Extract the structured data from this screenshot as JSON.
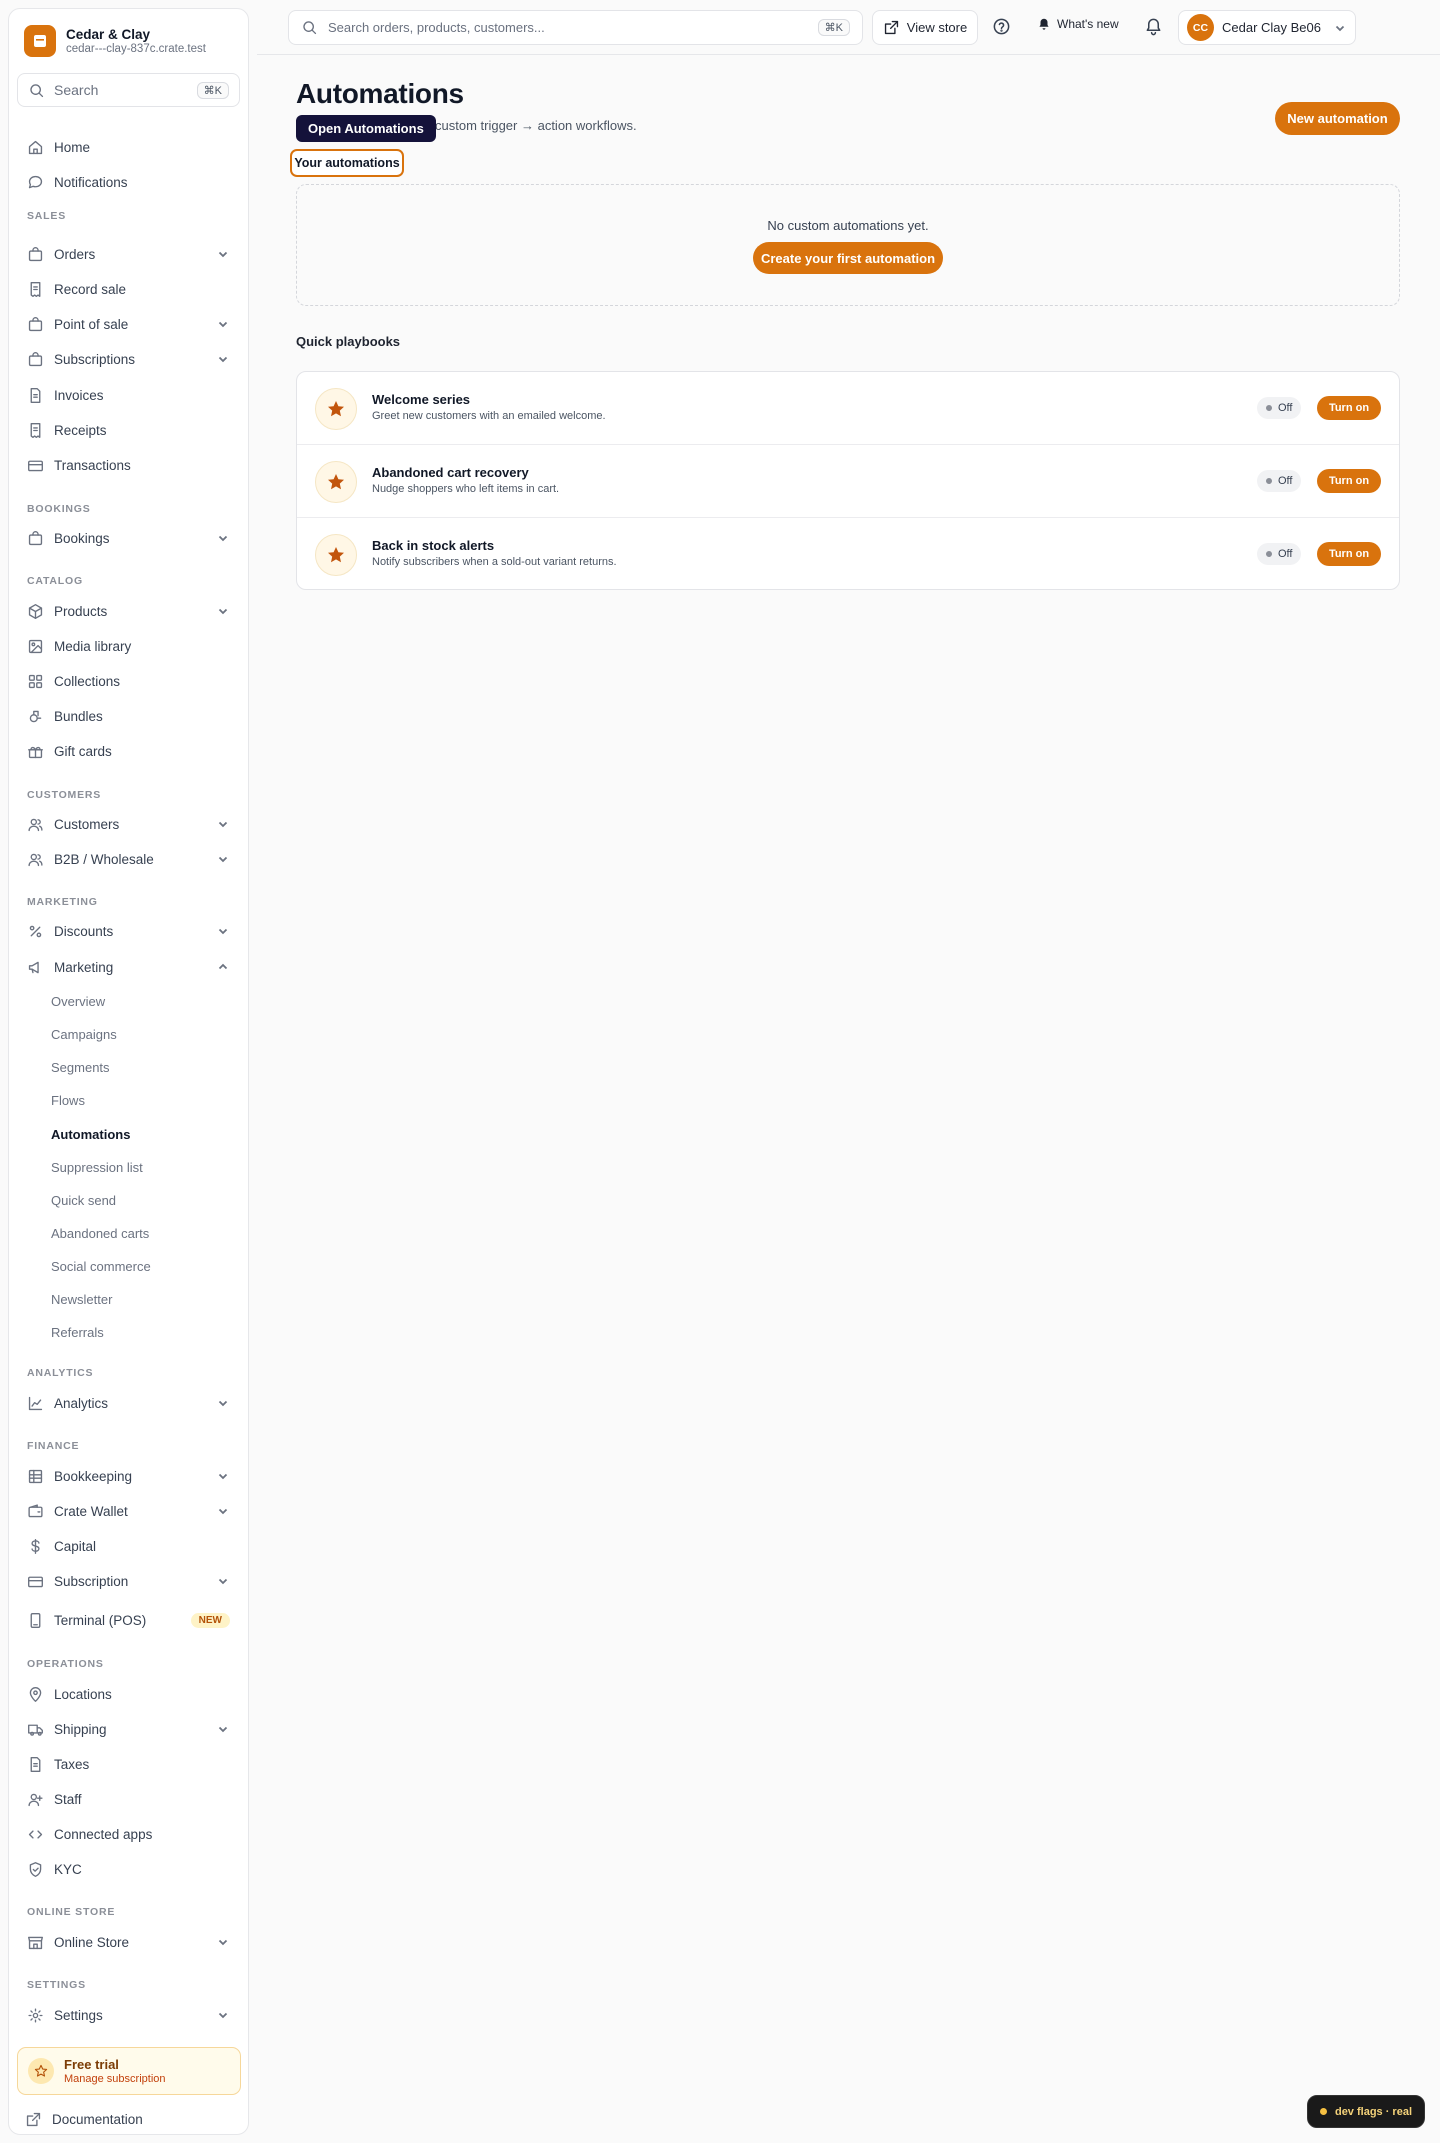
{
  "brand": {
    "name": "Cedar & Clay",
    "domain": "cedar---clay-837c.crate.test",
    "accent": "#d9730d"
  },
  "sidebar": {
    "search_label": "Search",
    "search_shortcut": "⌘K",
    "top_items": [
      {
        "label": "Home",
        "icon": "home-icon"
      },
      {
        "label": "Notifications",
        "icon": "chat-bubble-icon"
      }
    ],
    "sections": {
      "sales": "SALES",
      "bookings": "BOOKINGS",
      "catalog": "CATALOG",
      "customers": "CUSTOMERS",
      "marketing": "MARKETING",
      "analytics": "ANALYTICS",
      "finance": "FINANCE",
      "operations": "OPERATIONS",
      "online_store": "ONLINE STORE",
      "settings": "SETTINGS"
    },
    "items": {
      "orders": "Orders",
      "record_sale": "Record sale",
      "point_of_sale": "Point of sale",
      "subscriptions": "Subscriptions",
      "invoices": "Invoices",
      "receipts": "Receipts",
      "transactions": "Transactions",
      "bookings": "Bookings",
      "products": "Products",
      "media_library": "Media library",
      "collections": "Collections",
      "bundles": "Bundles",
      "gift_cards": "Gift cards",
      "customers": "Customers",
      "b2b": "B2B / Wholesale",
      "discounts": "Discounts",
      "marketing": "Marketing",
      "analytics": "Analytics",
      "bookkeeping": "Bookkeeping",
      "crate_wallet": "Crate Wallet",
      "capital": "Capital",
      "subscription": "Subscription",
      "terminal": "Terminal (POS)",
      "terminal_badge": "NEW",
      "locations": "Locations",
      "shipping": "Shipping",
      "taxes": "Taxes",
      "staff": "Staff",
      "connected_apps": "Connected apps",
      "kyc": "KYC",
      "online_store": "Online Store",
      "settings": "Settings"
    },
    "marketing_sub": [
      "Overview",
      "Campaigns",
      "Segments",
      "Flows",
      "Automations",
      "Suppression list",
      "Quick send",
      "Abandoned carts",
      "Social commerce",
      "Newsletter",
      "Referrals"
    ],
    "active_sub": "Automations",
    "trial": {
      "title": "Free trial",
      "subtitle": "Manage subscription"
    },
    "documentation": "Documentation"
  },
  "topbar": {
    "search_placeholder": "Search orders, products, customers...",
    "search_shortcut": "⌘K",
    "view_store": "View store",
    "whats_new": "What's new",
    "account_initials": "CC",
    "account_name": "Cedar Clay Be06"
  },
  "main": {
    "title": "Automations",
    "subtitle": "custom trigger → action workflows.",
    "tooltip": "Open Automations",
    "new_button": "New automation",
    "tab_label": "Your automations",
    "empty_text": "No custom automations yet.",
    "create_button": "Create your first automation",
    "playbooks_title": "Quick playbooks",
    "playbooks": [
      {
        "name": "Welcome series",
        "description": "Greet new customers with an emailed welcome.",
        "status": "Off",
        "action": "Turn on"
      },
      {
        "name": "Abandoned cart recovery",
        "description": "Nudge shoppers who left items in cart.",
        "status": "Off",
        "action": "Turn on"
      },
      {
        "name": "Back in stock alerts",
        "description": "Notify subscribers when a sold-out variant returns.",
        "status": "Off",
        "action": "Turn on"
      }
    ]
  },
  "dev_flags": "dev flags · real"
}
